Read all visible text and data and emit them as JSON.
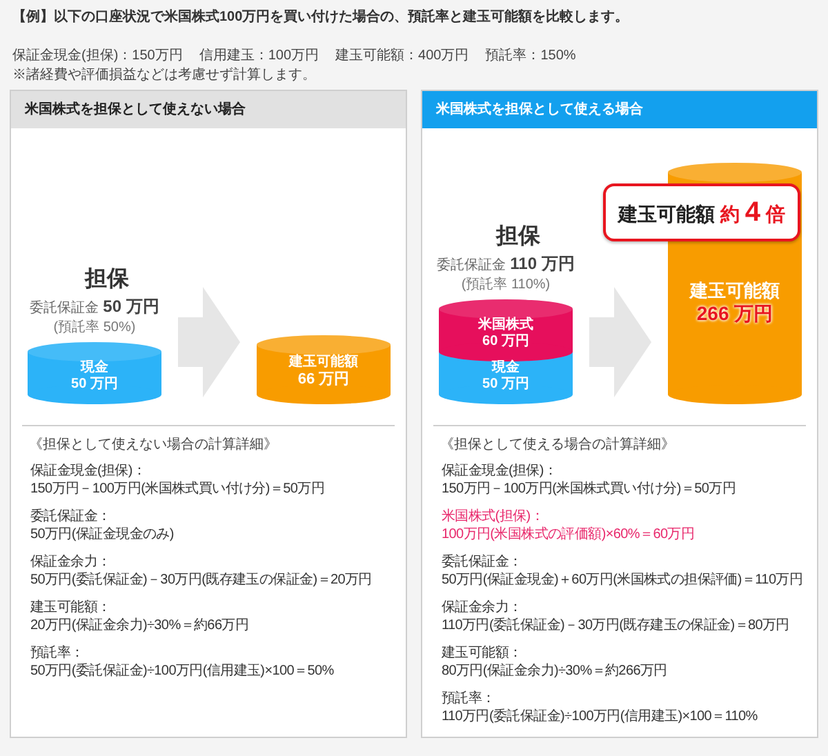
{
  "title": "【例】以下の口座状況で米国株式100万円を買い付けた場合の、預託率と建玉可能額を比較します。",
  "conditions": [
    "保証金現金(担保)：150万円",
    "信用建玉：100万円",
    "建玉可能額：400万円",
    "預託率：150%"
  ],
  "note": "※諸経費や評価損益などは考慮せず計算します。",
  "panels": [
    {
      "kind": "plain",
      "header": "米国株式を担保として使えない場合",
      "collateral": {
        "title": "担保",
        "deposit_label": "委託保証金",
        "deposit_amount": "50 万円",
        "rate": "(預託率 50%)",
        "segments": [
          {
            "label": "現金",
            "amount": "50 万円",
            "color": "#2cb3f8"
          }
        ]
      },
      "result": {
        "kind": "short",
        "label": "建玉可能額",
        "amount": "66 万円",
        "emphasized": false
      },
      "details": {
        "heading": "《担保として使えない場合の計算詳細》",
        "items": [
          {
            "label": "保証金現金(担保)：",
            "formula": "150万円－100万円(米国株式買い付け分)＝50万円",
            "highlighted": false
          },
          {
            "label": "委託保証金：",
            "formula": "50万円(保証金現金のみ)",
            "highlighted": false
          },
          {
            "label": "保証金余力：",
            "formula": "50万円(委託保証金)－30万円(既存建玉の保証金)＝20万円",
            "highlighted": false
          },
          {
            "label": "建玉可能額：",
            "formula": "20万円(保証金余力)÷30%＝約66万円",
            "highlighted": false
          },
          {
            "label": "預託率：",
            "formula": "50万円(委託保証金)÷100万円(信用建玉)×100＝50%",
            "highlighted": false
          }
        ]
      }
    },
    {
      "kind": "highlight",
      "header": "米国株式を担保として使える場合",
      "collateral": {
        "title": "担保",
        "deposit_label": "委託保証金",
        "deposit_amount": "110 万円",
        "rate": "(預託率 110%)",
        "segments": [
          {
            "label": "米国株式",
            "amount": "60 万円",
            "color": "#e60f5c"
          },
          {
            "label": "現金",
            "amount": "50 万円",
            "color": "#2cb3f8"
          }
        ]
      },
      "result": {
        "kind": "tall",
        "label": "建玉可能額",
        "amount": "266 万円",
        "emphasized": true,
        "badge": {
          "label": "建玉可能額",
          "prefix": "約",
          "number": "4",
          "suffix": "倍"
        }
      },
      "details": {
        "heading": "《担保として使える場合の計算詳細》",
        "items": [
          {
            "label": "保証金現金(担保)：",
            "formula": "150万円－100万円(米国株式買い付け分)＝50万円",
            "highlighted": false
          },
          {
            "label": "米国株式(担保)：",
            "formula": "100万円(米国株式の評価額)×60%＝60万円",
            "highlighted": true
          },
          {
            "label": "委託保証金：",
            "formula": "50万円(保証金現金)＋60万円(米国株式の担保評価)＝110万円",
            "highlighted": false
          },
          {
            "label": "保証金余力：",
            "formula": "110万円(委託保証金)－30万円(既存建玉の保証金)＝80万円",
            "highlighted": false
          },
          {
            "label": "建玉可能額：",
            "formula": "80万円(保証金余力)÷30%＝約266万円",
            "highlighted": false
          },
          {
            "label": "預託率：",
            "formula": "110万円(委託保証金)÷100万円(信用建玉)×100＝110%",
            "highlighted": false
          }
        ]
      }
    }
  ]
}
